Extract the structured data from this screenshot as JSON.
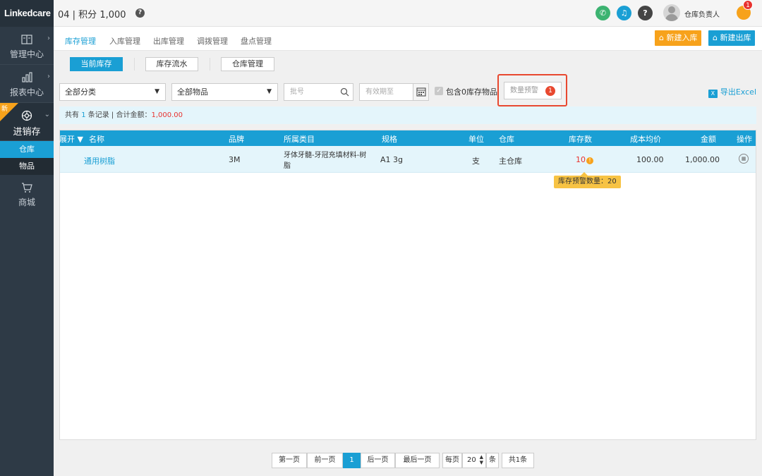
{
  "app": {
    "logo": "Linkedcare"
  },
  "header": {
    "title": "04 | 积分 1,000",
    "help": "?",
    "user_name": "仓库负责人",
    "notify_count": "1"
  },
  "sidebar": {
    "items": [
      {
        "label": "管理中心",
        "icon": "book-icon"
      },
      {
        "label": "报表中心",
        "icon": "bar-chart-icon"
      },
      {
        "label": "进销存",
        "icon": "settings-icon",
        "badge": "新"
      },
      {
        "label": "商城",
        "icon": "cart-icon"
      }
    ],
    "sub_items": [
      {
        "label": "仓库"
      },
      {
        "label": "物品"
      }
    ]
  },
  "tabs": [
    {
      "label": "库存管理"
    },
    {
      "label": "入库管理"
    },
    {
      "label": "出库管理"
    },
    {
      "label": "调拨管理"
    },
    {
      "label": "盘点管理"
    }
  ],
  "actions": {
    "new_inbound": "新建入库",
    "new_outbound": "新建出库"
  },
  "subtabs": [
    {
      "label": "当前库存"
    },
    {
      "label": "库存流水"
    },
    {
      "label": "仓库管理"
    }
  ],
  "filters": {
    "category": "全部分类",
    "items": "全部物品",
    "batch_placeholder": "批号",
    "expiry_placeholder": "有效期至",
    "include_zero": "包含0库存物品",
    "quantity_warning": "数量预警",
    "quantity_warning_count": "1",
    "export": "导出Excel"
  },
  "summary": {
    "prefix": "共有",
    "count": "1",
    "suffix": "条记录 | 合计金额：",
    "total": "1,000.00"
  },
  "table": {
    "headers": {
      "expand": "展开 ▼",
      "name": "名称",
      "brand": "品牌",
      "category": "所属类目",
      "spec": "规格",
      "unit": "单位",
      "warehouse": "仓库",
      "stock": "库存数",
      "avg_cost": "成本均价",
      "amount": "金额",
      "action": "操作"
    },
    "rows": [
      {
        "name": "通用树脂",
        "brand": "3M",
        "category_line1": "牙体牙髓-牙冠充填材料-树",
        "category_line2": "脂",
        "spec": "A1 3g",
        "unit": "支",
        "warehouse": "主仓库",
        "stock": "10",
        "avg_cost": "100.00",
        "amount": "1,000.00"
      }
    ],
    "tooltip": "库存预警数量：20"
  },
  "pager": {
    "first": "第一页",
    "prev": "前一页",
    "current": "1",
    "next": "后一页",
    "last": "最后一页",
    "per_page_label": "每页",
    "per_page": "20",
    "unit": "条",
    "total": "共1条"
  }
}
